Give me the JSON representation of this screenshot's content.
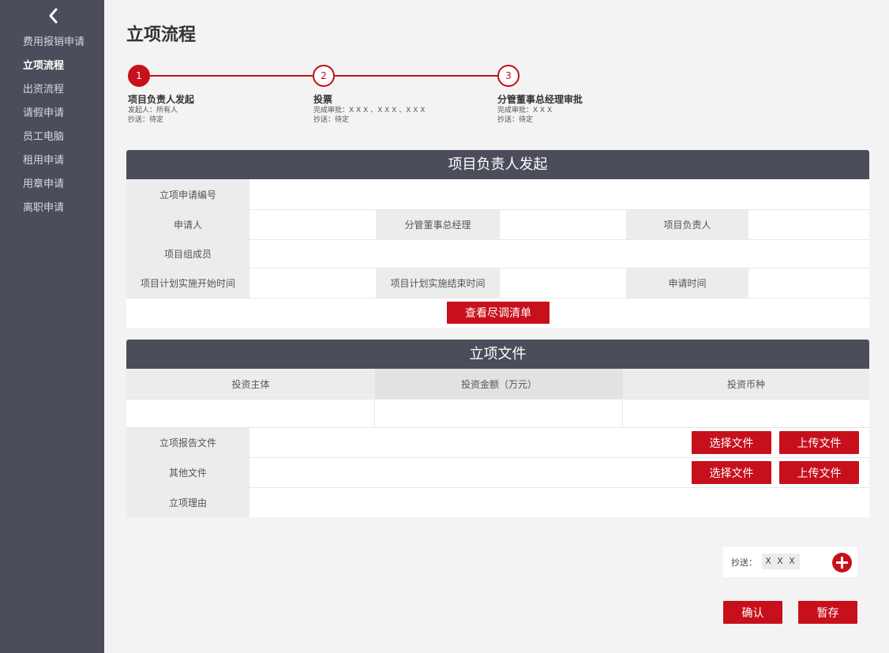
{
  "sidebar": {
    "items": [
      {
        "label": "费用报销申请"
      },
      {
        "label": "立项流程"
      },
      {
        "label": "出资流程"
      },
      {
        "label": "请假申请"
      },
      {
        "label": "员工电脑"
      },
      {
        "label": "租用申请"
      },
      {
        "label": "用章申请"
      },
      {
        "label": "离职申请"
      }
    ],
    "active_index": 1
  },
  "page": {
    "title": "立项流程"
  },
  "steps": [
    {
      "number": "1",
      "name": "项目负责人发起",
      "line1": "发起人：所有人",
      "line2": "抄送：待定"
    },
    {
      "number": "2",
      "name": "投票",
      "line1": "完成审批：X X X 、X X X 、X X X",
      "line2": "抄送：待定"
    },
    {
      "number": "3",
      "name": "分管董事总经理审批",
      "line1": "完成审批：X X X",
      "line2": "抄送：待定"
    }
  ],
  "section1": {
    "title": "项目负责人发起",
    "apply_no": "立项申请编号",
    "applicant": "申请人",
    "gm": "分管董事总经理",
    "project_lead": "项目负责人",
    "members": "项目组成员",
    "start_time": "项目计划实施开始时间",
    "end_time": "项目计划实施结束时间",
    "apply_time": "申请时间",
    "check_button": "查看尽调清单"
  },
  "section2": {
    "title": "立项文件",
    "col_entity": "投资主体",
    "col_amount": "投资金额（万元）",
    "col_currency": "投资币种",
    "report_file": "立项报告文件",
    "other_file": "其他文件",
    "reason": "立项理由",
    "choose_button": "选择文件",
    "upload_button": "上传文件"
  },
  "cc": {
    "label": "抄送：",
    "value": "X X X"
  },
  "actions": {
    "confirm": "确认",
    "save": "暂存"
  },
  "colors": {
    "accent": "#c7101c",
    "sidebar": "#4c4d5a",
    "label_bg": "#ececec"
  }
}
